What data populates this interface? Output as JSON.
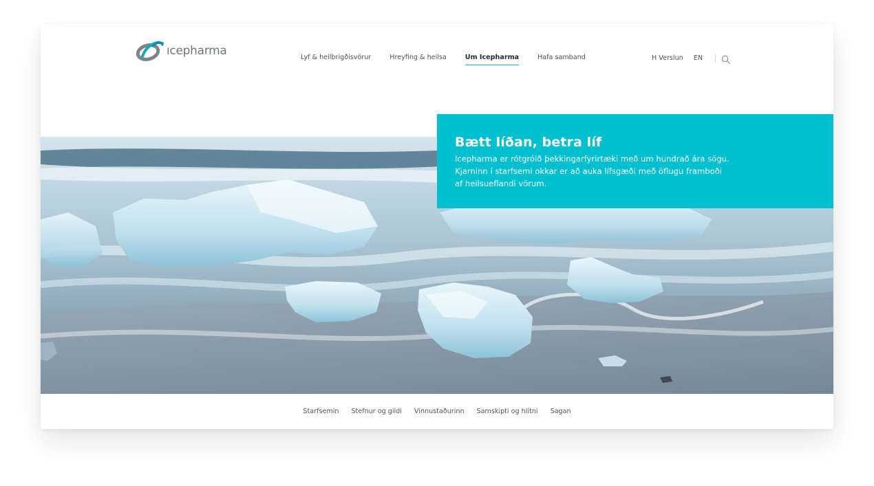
{
  "brand": {
    "name": "Icepharma",
    "logo_text": "ıcepharma",
    "colors": {
      "accent": "#00bfcf",
      "logo_gray": "#6f777b",
      "logo_teal": "#1aa7b8"
    }
  },
  "header": {
    "main_nav": [
      {
        "label": "Lyf & heilbrigðisvörur",
        "active": false
      },
      {
        "label": "Hreyfing & heilsa",
        "active": false
      },
      {
        "label": "Um Icepharma",
        "active": true
      },
      {
        "label": "Hafa samband",
        "active": false
      }
    ],
    "util_nav": {
      "store_label": "H Verslun",
      "language_label": "EN",
      "search_icon": "search-icon"
    }
  },
  "hero": {
    "image": "glacier ice on black sand beach with waves",
    "title": "Bætt líðan, betra líf",
    "body": "Icepharma er rótgróið þekkingarfyrirtæki með um hundrað ára sögu. Kjarninn í starfsemi okkar er að auka lífsgæði með öflugu framboði af heilsueflandi vörum."
  },
  "sub_nav": [
    {
      "label": "Starfsemin"
    },
    {
      "label": "Stefnur og gildi"
    },
    {
      "label": "Vinnustaðurinn"
    },
    {
      "label": "Samskipti og hlítni"
    },
    {
      "label": "Sagan"
    }
  ]
}
